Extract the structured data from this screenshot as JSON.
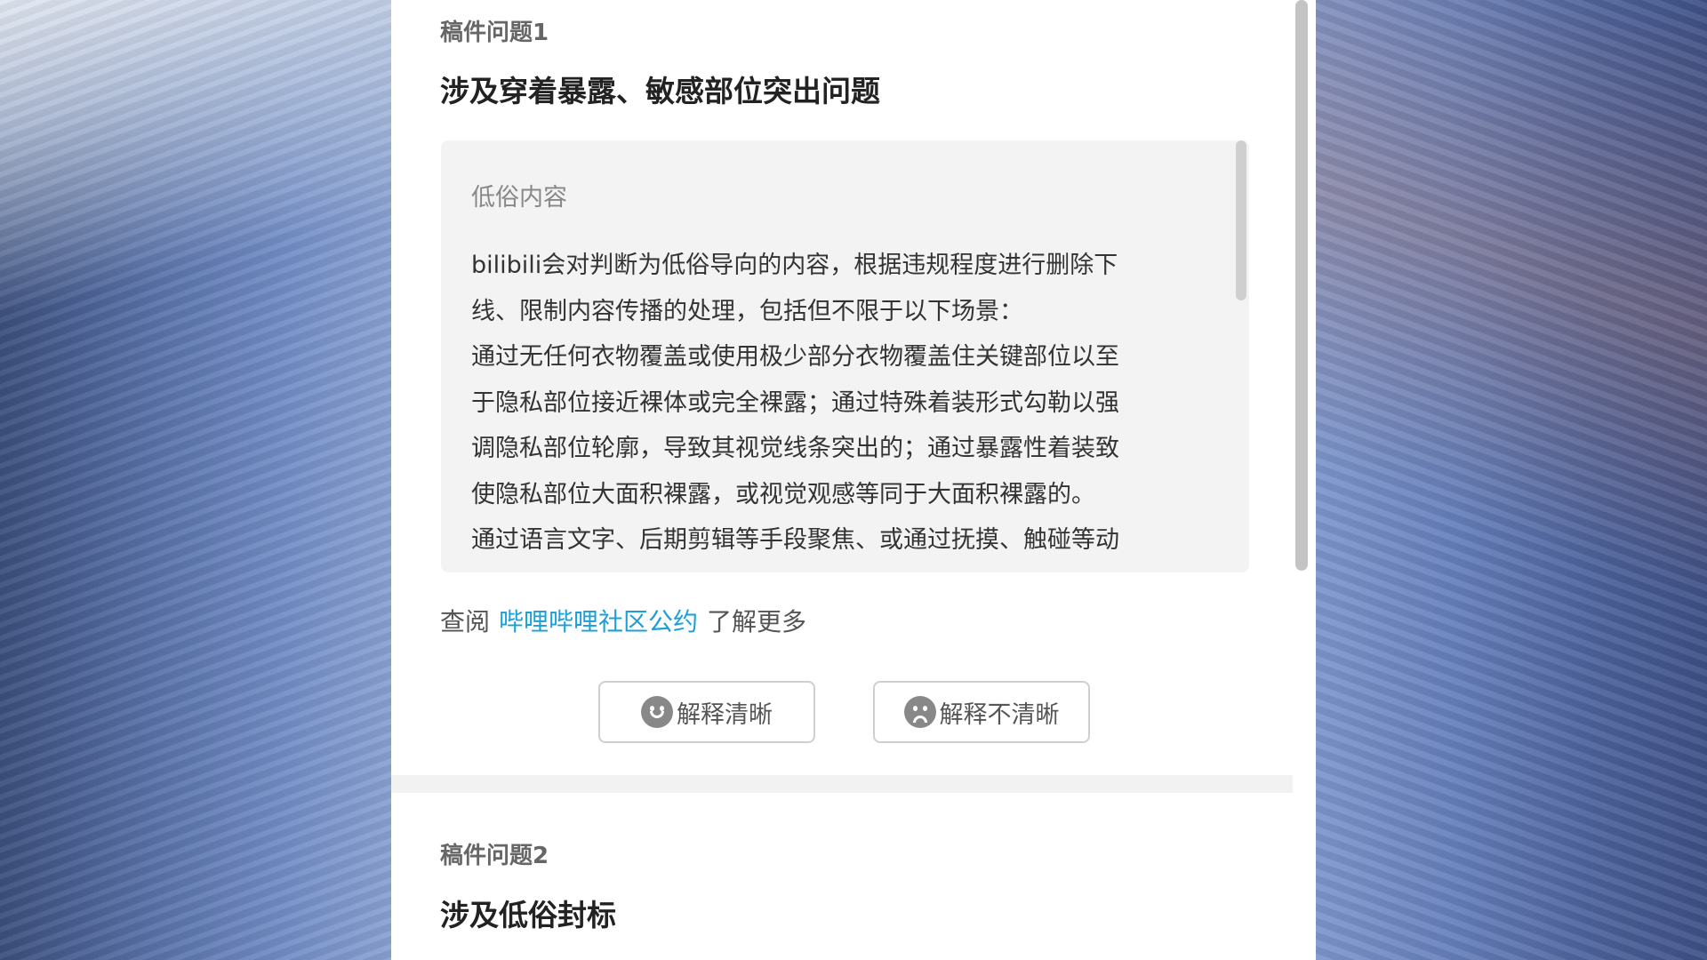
{
  "issues": [
    {
      "number_label": "稿件问题1",
      "title": "涉及穿着暴露、敏感部位突出问题"
    },
    {
      "number_label": "稿件问题2",
      "title": "涉及低俗封标"
    }
  ],
  "rule": {
    "heading": "低俗内容",
    "lines": [
      "bilibili会对判断为低俗导向的内容，根据违规程度进行删除下",
      "线、限制内容传播的处理，包括但不限于以下场景：",
      "通过无任何衣物覆盖或使用极少部分衣物覆盖住关键部位以至",
      "于隐私部位接近裸体或完全裸露；通过特殊着装形式勾勒以强",
      "调隐私部位轮廓，导致其视觉线条突出的；通过暴露性着装致",
      "使隐私部位大面积裸露，或视觉观感等同于大面积裸露的。",
      "通过语言文字、后期剪辑等手段聚焦、或通过抚摸、触碰等动"
    ]
  },
  "more": {
    "prefix": "查阅",
    "link": "哔哩哔哩社区公约",
    "suffix": "了解更多"
  },
  "feedback": {
    "clear_label": "解释清晰",
    "unclear_label": "解释不清晰"
  },
  "icons": {
    "clear": "smile-face-icon",
    "unclear": "sad-face-icon"
  },
  "colors": {
    "link": "#1aa0d8",
    "panel_bg": "#ffffff",
    "rule_box_bg": "#f3f3f3"
  }
}
